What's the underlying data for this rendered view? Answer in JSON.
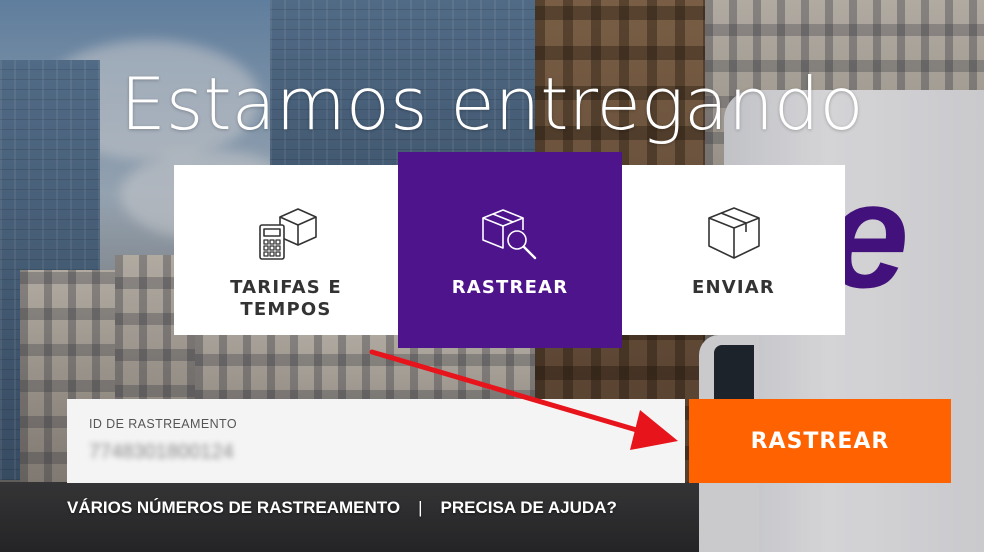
{
  "hero": {
    "title": "Estamos entregando"
  },
  "tabs": [
    {
      "label": "TARIFAS E\nTEMPOS",
      "line1": "TARIFAS E",
      "line2": "TEMPOS",
      "icon": "calculator-box-icon",
      "active": false
    },
    {
      "label": "RASTREAR",
      "icon": "box-magnifier-icon",
      "active": true
    },
    {
      "label": "ENVIAR",
      "icon": "box-icon",
      "active": false
    }
  ],
  "tracking": {
    "field_label": "ID DE RASTREAMENTO",
    "value": "7748301800124",
    "button_label": "RASTREAR"
  },
  "links": {
    "multiple": "VÁRIOS NÚMEROS DE RASTREAMENTO",
    "separator": "|",
    "help": "PRECISA DE AJUDA?"
  },
  "colors": {
    "fedex_purple": "#4d148c",
    "fedex_orange": "#ff6200",
    "annotation_arrow": "#e8141c"
  },
  "annotation": {
    "type": "arrow",
    "icon": "red-arrow-icon"
  }
}
